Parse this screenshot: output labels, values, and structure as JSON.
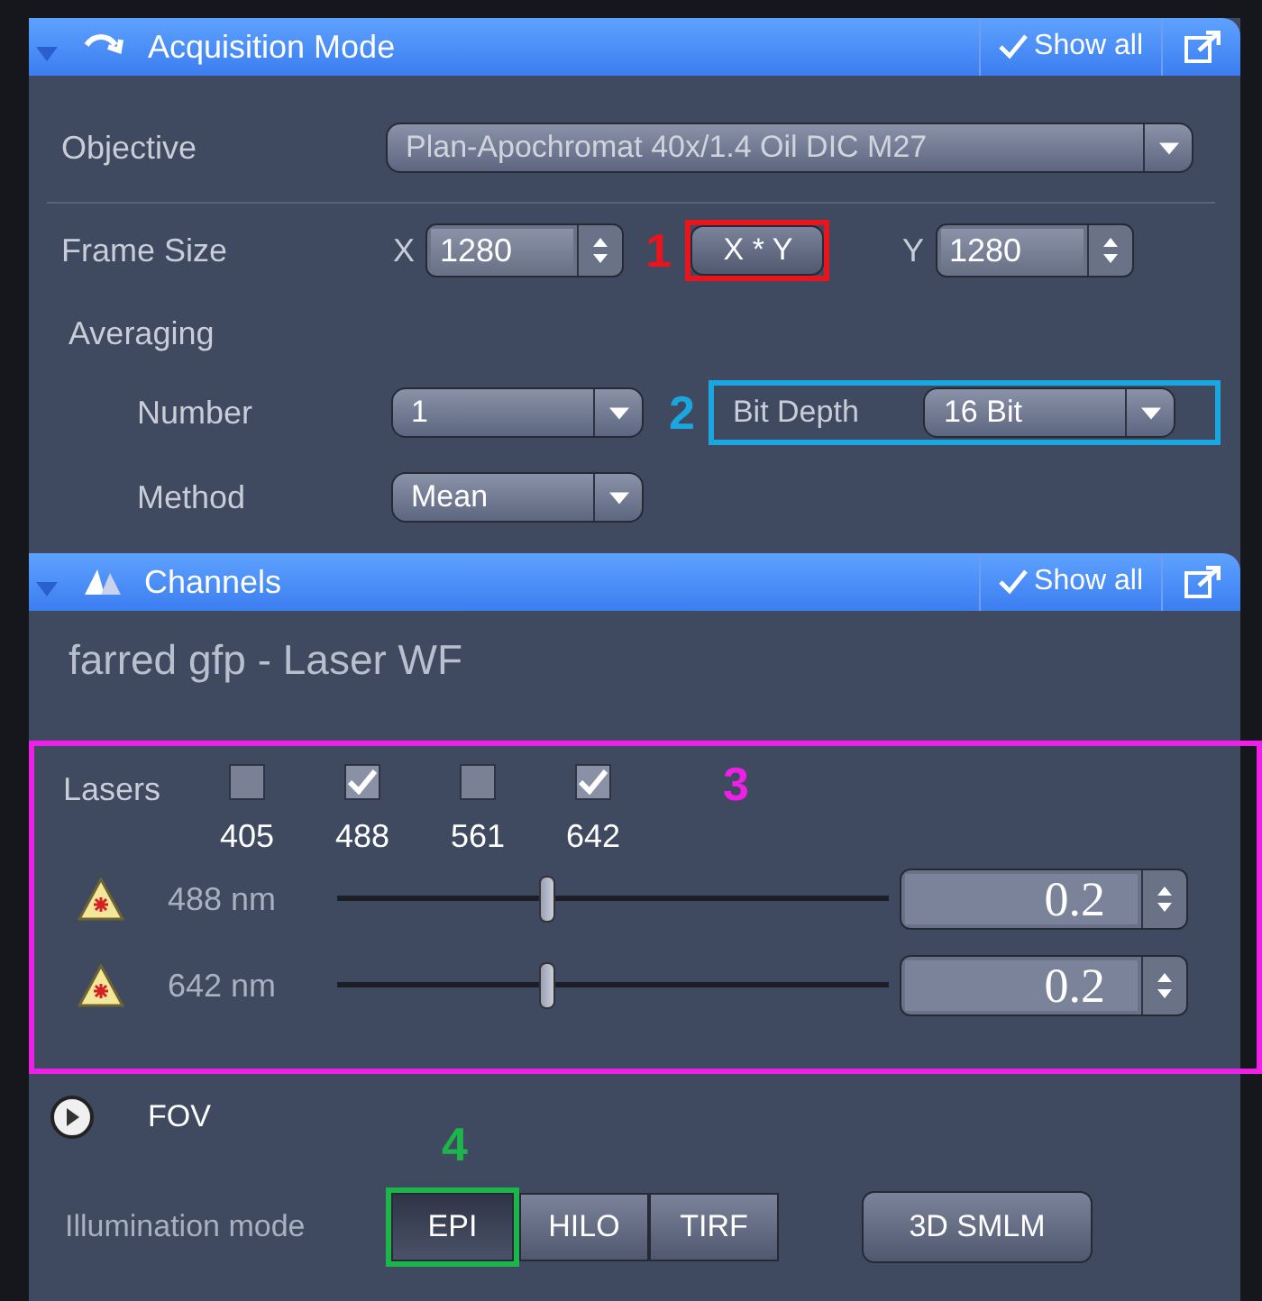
{
  "acquisition": {
    "title": "Acquisition Mode",
    "show_all": "Show all",
    "objective": {
      "label": "Objective",
      "value": "Plan-Apochromat 40x/1.4 Oil DIC M27"
    },
    "frame_size": {
      "label": "Frame Size",
      "x_label": "X",
      "x_value": "1280",
      "xy_button": "X * Y",
      "y_label": "Y",
      "y_value": "1280"
    },
    "averaging": {
      "label": "Averaging",
      "number_label": "Number",
      "number_value": "1",
      "method_label": "Method",
      "method_value": "Mean"
    },
    "bit_depth": {
      "label": "Bit Depth",
      "value": "16 Bit"
    }
  },
  "channels": {
    "title": "Channels",
    "show_all": "Show all",
    "channel_name": "farred gfp - Laser WF",
    "lasers_label": "Lasers",
    "lasers": [
      {
        "label": "405",
        "checked": false
      },
      {
        "label": "488",
        "checked": true
      },
      {
        "label": "561",
        "checked": false
      },
      {
        "label": "642",
        "checked": true
      }
    ],
    "power": [
      {
        "label": "488 nm",
        "level": 0.38,
        "value": "0.2"
      },
      {
        "label": "642 nm",
        "level": 0.38,
        "value": "0.2"
      }
    ],
    "fov": {
      "label": "FOV",
      "expanded": false
    },
    "illumination": {
      "label": "Illumination mode",
      "modes": [
        {
          "label": "EPI",
          "selected": true
        },
        {
          "label": "HILO",
          "selected": false
        },
        {
          "label": "TIRF",
          "selected": false
        }
      ]
    },
    "smlm_button": "3D SMLM"
  },
  "annotations": [
    {
      "label": "1",
      "color": "#e8141e"
    },
    {
      "label": "2",
      "color": "#1aa7e0"
    },
    {
      "label": "3",
      "color": "#ee1fe6"
    },
    {
      "label": "4",
      "color": "#1db44c"
    }
  ]
}
